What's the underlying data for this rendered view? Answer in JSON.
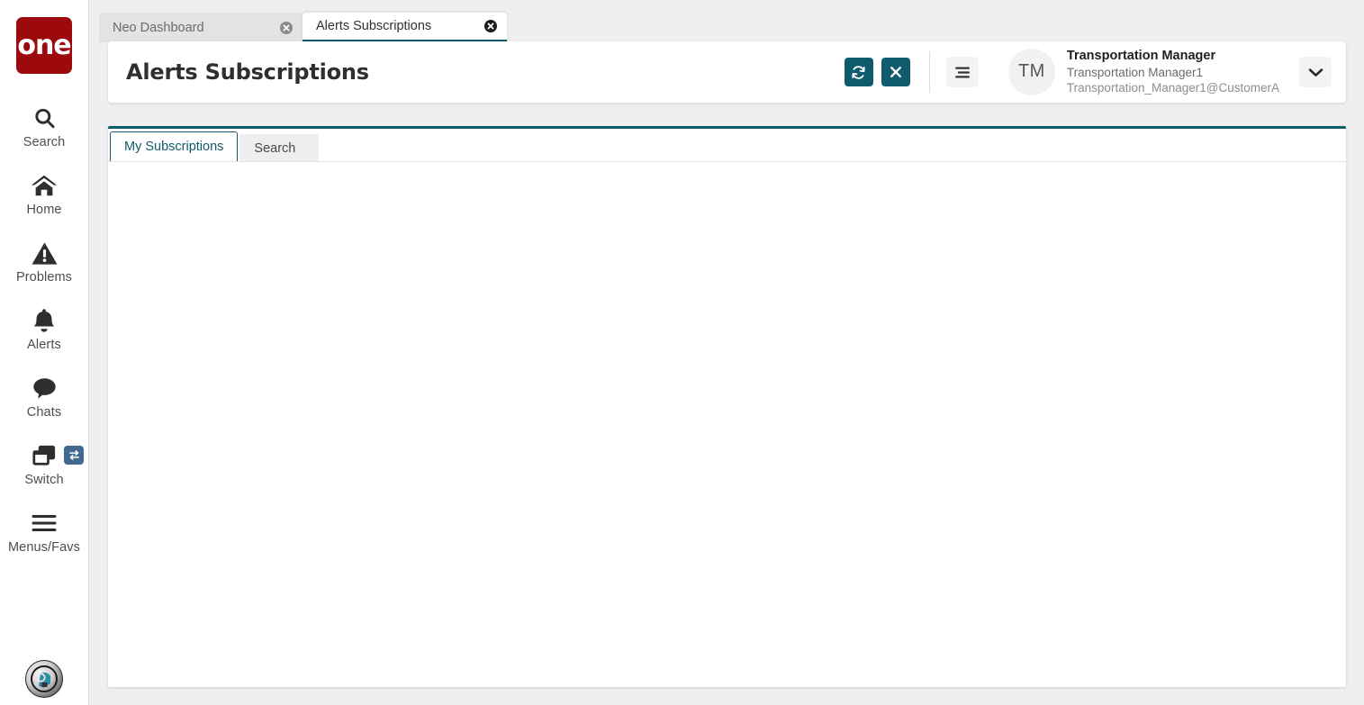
{
  "brand": {
    "logo_text": "one",
    "logo_color": "#9c0a0e"
  },
  "theme": {
    "accent": "#0f5b6e",
    "badge": "#41698f",
    "page_bg": "#efefef"
  },
  "sidebar": {
    "items": [
      {
        "label": "Search",
        "icon": "search-icon"
      },
      {
        "label": "Home",
        "icon": "home-icon"
      },
      {
        "label": "Problems",
        "icon": "warning-triangle-icon"
      },
      {
        "label": "Alerts",
        "icon": "bell-icon"
      },
      {
        "label": "Chats",
        "icon": "chat-bubble-icon"
      },
      {
        "label": "Switch",
        "icon": "windows-stack-icon",
        "badge_icon": "swap-arrows-icon"
      },
      {
        "label": "Menus/Favs",
        "icon": "hamburger-icon"
      }
    ],
    "assistant_icon": "ai-assistant-avatar"
  },
  "browser_tabs": [
    {
      "title": "Neo Dashboard",
      "active": false,
      "close_icon": "close-circle-icon"
    },
    {
      "title": "Alerts Subscriptions",
      "active": true,
      "close_icon": "close-circle-icon"
    }
  ],
  "header": {
    "title": "Alerts Subscriptions",
    "actions": [
      {
        "name": "refresh-button",
        "icon": "refresh-icon"
      },
      {
        "name": "close-button",
        "icon": "x-icon"
      }
    ],
    "menu_icon": "hamburger-menu-icon",
    "dropdown_icon": "chevron-down-icon",
    "user": {
      "initials": "TM",
      "name": "Transportation Manager",
      "username": "Transportation Manager1",
      "email": "Transportation_Manager1@CustomerA"
    }
  },
  "content": {
    "tabs": [
      {
        "label": "My Subscriptions",
        "active": true
      },
      {
        "label": "Search",
        "active": false
      }
    ],
    "body_text": ""
  }
}
